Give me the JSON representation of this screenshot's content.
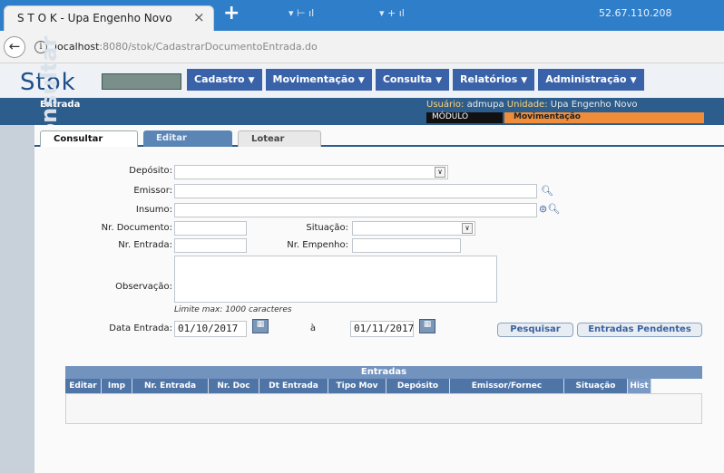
{
  "browser": {
    "tab_title": "S T O K - Upa Engenho Novo",
    "tab_close": "×",
    "new_tab": "+",
    "ip": "52.67.110.208",
    "url_host": "localhost",
    "url_port": ":8080",
    "url_path": "/stok/CadastrarDocumentoEntrada.do"
  },
  "app": {
    "logo": "Stok",
    "menu": [
      {
        "label": "Cadastro"
      },
      {
        "label": "Movimentação"
      },
      {
        "label": "Consulta"
      },
      {
        "label": "Relatórios"
      },
      {
        "label": "Administração"
      }
    ],
    "section_title": "Entrada",
    "user_label": "Usuário:",
    "user_value": "admupa",
    "unit_label": "Unidade:",
    "unit_value": "Upa Engenho Novo",
    "modulo_label": "MÓDULO",
    "modulo_value": "Movimentação",
    "sidebar_text": "Consultar"
  },
  "tabs": [
    "Consultar",
    "Editar",
    "Lotear"
  ],
  "form": {
    "deposito_label": "Depósito:",
    "emissor_label": "Emissor:",
    "insumo_label": "Insumo:",
    "nr_documento_label": "Nr. Documento:",
    "situacao_label": "Situação:",
    "nr_entrada_label": "Nr. Entrada:",
    "nr_empenho_label": "Nr. Empenho:",
    "observacao_label": "Observação:",
    "limit_hint": "Limite max: 1000 caracteres",
    "data_entrada_label": "Data Entrada:",
    "data_inicio": "01/10/2017",
    "a_label": "à",
    "data_fim": "01/11/2017",
    "pesquisar": "Pesquisar",
    "entradas_pendentes": "Entradas Pendentes"
  },
  "grid": {
    "caption": "Entradas",
    "columns": [
      "Editar",
      "Imp",
      "Nr. Entrada",
      "Nr. Doc",
      "Dt Entrada",
      "Tipo Mov",
      "Depósito",
      "Emissor/Fornec",
      "Situação",
      "Hist"
    ]
  }
}
